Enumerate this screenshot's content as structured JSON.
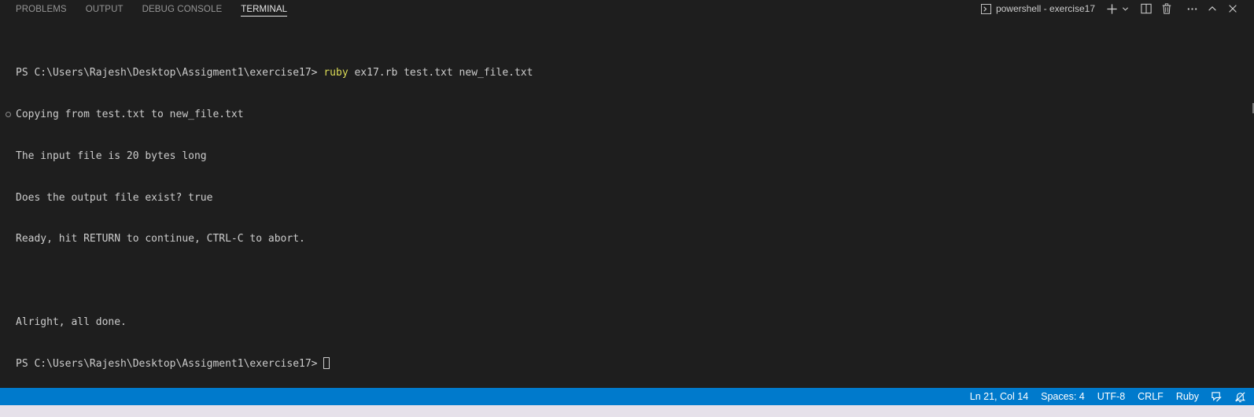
{
  "panel": {
    "tabs": [
      {
        "label": "PROBLEMS",
        "active": false
      },
      {
        "label": "OUTPUT",
        "active": false
      },
      {
        "label": "DEBUG CONSOLE",
        "active": false
      },
      {
        "label": "TERMINAL",
        "active": true
      }
    ],
    "terminal_selector": {
      "icon": "terminal-prompt-icon",
      "label": "powershell - exercise17"
    },
    "actions": [
      {
        "name": "new-terminal",
        "icon": "plus-icon"
      },
      {
        "name": "launch-profile",
        "icon": "chevron-down-icon"
      },
      {
        "name": "split-terminal",
        "icon": "split-icon"
      },
      {
        "name": "kill-terminal",
        "icon": "trash-icon"
      },
      {
        "name": "more-actions",
        "icon": "ellipsis-icon"
      },
      {
        "name": "maximize-panel",
        "icon": "chevron-up-icon"
      },
      {
        "name": "close-panel",
        "icon": "close-icon"
      }
    ]
  },
  "terminal": {
    "prompt": "PS C:\\Users\\Rajesh\\Desktop\\Assigment1\\exercise17> ",
    "command_word": "ruby",
    "command_args": " ex17.rb test.txt new_file.txt",
    "output": [
      "Copying from test.txt to new_file.txt",
      "The input file is 20 bytes long",
      "Does the output file exist? true",
      "Ready, hit RETURN to continue, CTRL-C to abort.",
      "",
      "Alright, all done."
    ],
    "final_prompt": "PS C:\\Users\\Rajesh\\Desktop\\Assigment1\\exercise17> "
  },
  "statusbar": {
    "position": "Ln 21, Col 14",
    "indentation": "Spaces: 4",
    "encoding": "UTF-8",
    "eol": "CRLF",
    "language": "Ruby",
    "icons": [
      "feedback-icon",
      "notifications-off-icon"
    ]
  },
  "colors": {
    "background": "#1e1e1e",
    "foreground": "#cccccc",
    "command": "#dcdc56",
    "statusbar": "#007acc"
  }
}
